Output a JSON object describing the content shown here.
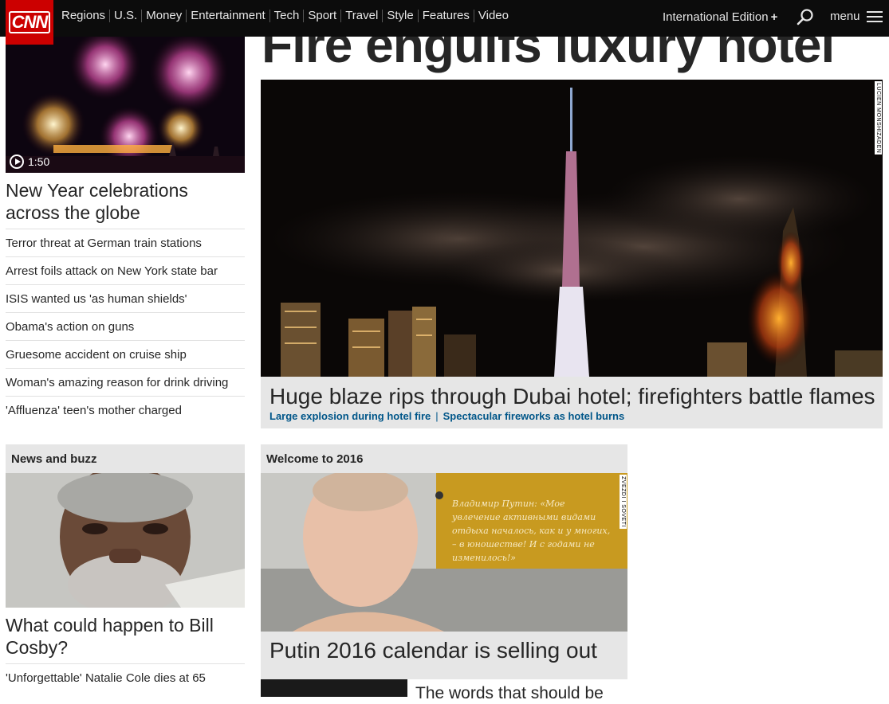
{
  "nav": {
    "logo": "CNN",
    "links": [
      "Regions",
      "U.S.",
      "Money",
      "Entertainment",
      "Tech",
      "Sport",
      "Travel",
      "Style",
      "Features",
      "Video"
    ],
    "edition": "International Edition",
    "edition_plus": "+",
    "menu_label": "menu"
  },
  "left": {
    "video_duration": "1:50",
    "headline": "New Year celebrations across the globe",
    "stories": [
      "Terror threat at German train stations",
      "Arrest foils attack on New York state bar",
      "ISIS wanted us 'as human shields'",
      "Obama's action on guns",
      "Gruesome accident on cruise ship",
      "Woman's amazing reason for drink driving",
      "'Affluenza' teen's mother charged"
    ]
  },
  "main": {
    "headline": "Fire engulfs luxury hotel",
    "hero_credit": "LUCIEN MONSHIZADEN",
    "hero_title": "Huge blaze rips through Dubai hotel; firefighters battle flames",
    "related": [
      "Large explosion during hotel fire",
      "Spectacular fireworks as hotel burns"
    ]
  },
  "buzz": {
    "section_title": "News and buzz",
    "headline": "What could happen to Bill Cosby?",
    "stories": [
      "'Unforgettable' Natalie Cole dies at 65"
    ]
  },
  "welcome": {
    "section_title": "Welcome to 2016",
    "credit": "ZVEZDI I SOVETI",
    "calendar_text": "Владимир Путин: «Мое увлечение активными видами отдыха началось, как и у многих, – в юношестве! И с годами не изменилось!»",
    "headline": "Putin 2016 calendar is selling out",
    "sub_headline": "The words that should be"
  },
  "colors": {
    "brand_red": "#cc0000",
    "nav_bg": "#0c0c0c",
    "link_blue": "#005689",
    "caption_bg": "#e6e6e6"
  }
}
